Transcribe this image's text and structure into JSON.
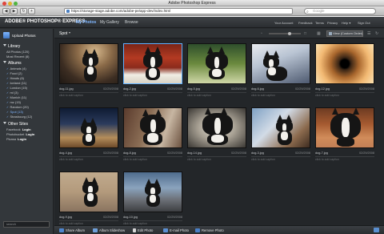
{
  "browser": {
    "window_title": "Adobe Photoshop Express",
    "url": "https://storage-stage.adobe.com/adobe-pe/app-dev/index.html",
    "search_placeholder": "Google"
  },
  "app": {
    "brand": "ADOBE® PHOTOSHOP® EXPRESS",
    "beta_tag": "BETA",
    "nav": [
      {
        "label": "My Photos",
        "active": true
      },
      {
        "label": "My Gallery",
        "active": false
      },
      {
        "label": "Browse",
        "active": false
      }
    ],
    "top_links": [
      "Your Account",
      "Feedback",
      "Terms",
      "Privacy",
      "Help ▾",
      "Sign Out"
    ]
  },
  "sidebar": {
    "upload_label": "Upload Photos",
    "library_title": "Library",
    "library_items": [
      "All Photos (120)",
      "Most Recent (8)"
    ],
    "albums_title": "Albums",
    "albums": [
      {
        "label": "Animals (4)",
        "selected": false
      },
      {
        "label": "Food (2)",
        "selected": false
      },
      {
        "label": "Heads (6)",
        "selected": false
      },
      {
        "label": "Iceland (11)",
        "selected": false
      },
      {
        "label": "London (15)",
        "selected": false
      },
      {
        "label": "ml (3)",
        "selected": false
      },
      {
        "label": "Munich (11)",
        "selected": false
      },
      {
        "label": "mz (15)",
        "selected": false
      },
      {
        "label": "Random (20)",
        "selected": false
      },
      {
        "label": "Spot (13)",
        "selected": true
      },
      {
        "label": "Strasbourg (12)",
        "selected": false
      }
    ],
    "other_title": "Other Sites",
    "other_sites": [
      {
        "site": "Facebook",
        "action": "Login"
      },
      {
        "site": "Photobucket",
        "action": "Login"
      },
      {
        "site": "Picasa",
        "action": "Login"
      }
    ],
    "search_placeholder": "search"
  },
  "content": {
    "album_title": "Spot",
    "view_select": "View (Custom Order)",
    "caption_placeholder": "click to add caption",
    "photos": [
      {
        "name": "dog-11.jpg",
        "date": "02/29/2008"
      },
      {
        "name": "dog-2.jpg",
        "date": "02/29/2008"
      },
      {
        "name": "dog-5.jpg",
        "date": "02/29/2008"
      },
      {
        "name": "dog-6.jpg",
        "date": "02/29/2008"
      },
      {
        "name": "dog-12.jpg",
        "date": "02/29/2008"
      },
      {
        "name": "dog-4.jpg",
        "date": "02/29/2008"
      },
      {
        "name": "dog-8.jpg",
        "date": "02/29/2008"
      },
      {
        "name": "dog-14.jpg",
        "date": "02/29/2008"
      },
      {
        "name": "dog-3.jpg",
        "date": "02/29/2008"
      },
      {
        "name": "dog-7.jpg",
        "date": "02/29/2008"
      },
      {
        "name": "dog-9.jpg",
        "date": "02/29/2008"
      },
      {
        "name": "dog-10.jpg",
        "date": "02/29/2008"
      }
    ]
  },
  "actions": [
    "Share Album",
    "Album Slideshow",
    "Edit Photo",
    "E-mail Photo",
    "Remove Photo"
  ]
}
